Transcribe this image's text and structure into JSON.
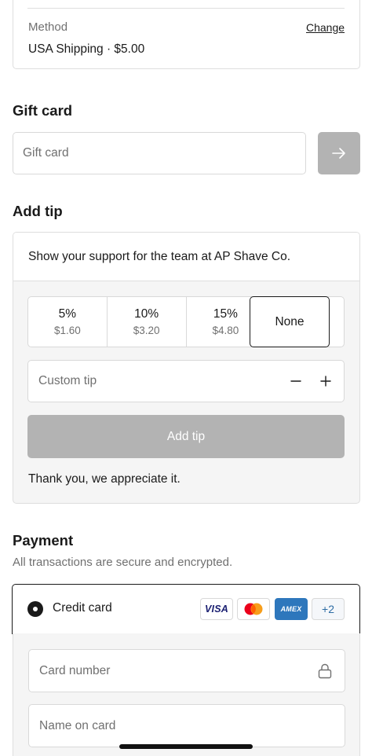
{
  "shipping": {
    "method_label": "Method",
    "change_label": "Change",
    "method_value": "USA Shipping · $5.00"
  },
  "gift_card": {
    "title": "Gift card",
    "placeholder": "Gift card",
    "submit_icon": "arrow-right-icon"
  },
  "tip": {
    "title": "Add tip",
    "support_text": "Show your support for the team at AP Shave Co.",
    "options": [
      {
        "percent": "5%",
        "amount": "$1.60"
      },
      {
        "percent": "10%",
        "amount": "$3.20"
      },
      {
        "percent": "15%",
        "amount": "$4.80"
      },
      {
        "percent": "None",
        "amount": ""
      }
    ],
    "selected": "None",
    "custom_placeholder": "Custom tip",
    "add_button": "Add tip",
    "thanks": "Thank you, we appreciate it."
  },
  "payment": {
    "title": "Payment",
    "subtitle": "All transactions are secure and encrypted.",
    "method_label": "Credit card",
    "card_brands": [
      "VISA",
      "mastercard",
      "AMEX"
    ],
    "more_brands": "+2",
    "card_number_placeholder": "Card number",
    "name_placeholder": "Name on card"
  },
  "colors": {
    "accent_disabled": "#b3b3b3",
    "border": "#d9d9d9",
    "muted_text": "#707070",
    "amex_blue": "#2e77bc",
    "visa_navy": "#1a1f71"
  }
}
